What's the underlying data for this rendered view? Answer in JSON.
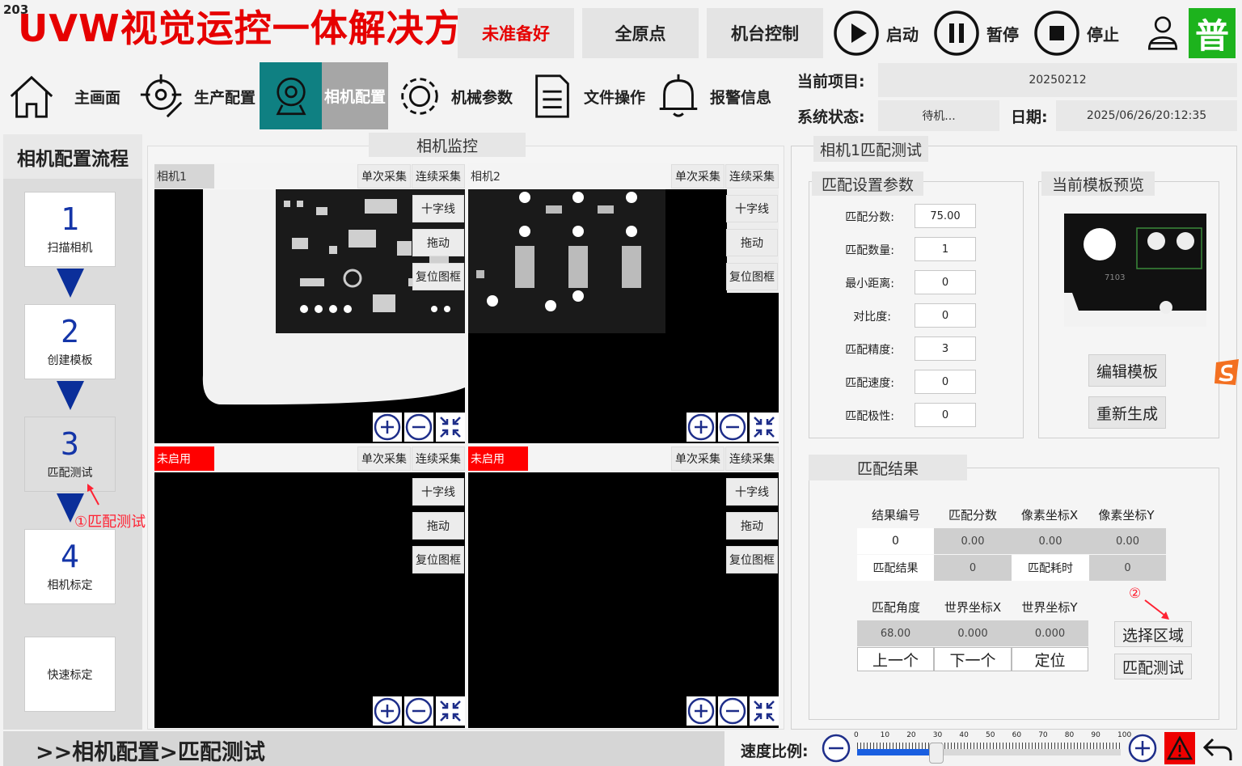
{
  "corner_number": "203",
  "app_title": "UVW视觉运控一体解决方案",
  "header": {
    "status_button": "未准备好",
    "home_button": "全原点",
    "machine_button": "机台控制",
    "start_label": "启动",
    "pause_label": "暂停",
    "stop_label": "停止",
    "user_level_badge": "普"
  },
  "nav": {
    "items": [
      {
        "label": "主画面",
        "icon": "home-icon"
      },
      {
        "label": "生产配置",
        "icon": "crosshair-gear-icon"
      },
      {
        "label": "相机配置",
        "icon": "camera-icon",
        "active": true
      },
      {
        "label": "机械参数",
        "icon": "gear-icon"
      },
      {
        "label": "文件操作",
        "icon": "document-icon"
      },
      {
        "label": "报警信息",
        "icon": "bell-icon"
      }
    ]
  },
  "info": {
    "project_label": "当前项目:",
    "project_value": "20250212",
    "system_status_label": "系统状态:",
    "system_status_value": "待机...",
    "date_label": "日期:",
    "date_value": "2025/06/26/20:12:35"
  },
  "steps": {
    "title": "相机配置流程",
    "items": [
      {
        "num": "1",
        "name": "扫描相机"
      },
      {
        "num": "2",
        "name": "创建模板"
      },
      {
        "num": "3",
        "name": "匹配测试"
      },
      {
        "num": "4",
        "name": "相机标定"
      }
    ],
    "quick_calibration": "快速标定",
    "annotation_1": "①匹配测试"
  },
  "monitor": {
    "title": "相机监控",
    "cameras": [
      {
        "label": "相机1",
        "enabled": true
      },
      {
        "label": "相机2",
        "enabled": true
      },
      {
        "label": "未启用",
        "enabled": false
      },
      {
        "label": "未启用",
        "enabled": false
      }
    ],
    "buttons": {
      "single": "单次采集",
      "continuous": "连续采集",
      "crosshair": "十字线",
      "drag": "拖动",
      "reset_frame": "复位图框"
    }
  },
  "match_panel": {
    "title": "相机1匹配测试",
    "settings_title": "匹配设置参数",
    "params": [
      {
        "label": "匹配分数:",
        "value": "75.00"
      },
      {
        "label": "匹配数量:",
        "value": "1"
      },
      {
        "label": "最小距离:",
        "value": "0"
      },
      {
        "label": "对比度:",
        "value": "0"
      },
      {
        "label": "匹配精度:",
        "value": "3"
      },
      {
        "label": "匹配速度:",
        "value": "0"
      },
      {
        "label": "匹配极性:",
        "value": "0"
      }
    ],
    "preview_title": "当前模板预览",
    "edit_template": "编辑模板",
    "regenerate": "重新生成",
    "results_title": "匹配结果",
    "result_headers": [
      "结果编号",
      "匹配分数",
      "像素坐标X",
      "像素坐标Y"
    ],
    "result_id": "0",
    "result_score": "0.00",
    "result_px": "0.00",
    "result_py": "0.00",
    "match_result_label": "匹配结果",
    "match_result_value": "0",
    "match_time_label": "匹配耗时",
    "match_time_value": "0",
    "angle_headers": [
      "匹配角度",
      "世界坐标X",
      "世界坐标Y"
    ],
    "angle_value": "68.00",
    "world_x": "0.000",
    "world_y": "0.000",
    "prev_button": "上一个",
    "next_button": "下一个",
    "locate_button": "定位",
    "select_region_button": "选择区域",
    "match_test_button": "匹配测试",
    "annotation_2": "②"
  },
  "bottom": {
    "breadcrumb": ">>相机配置>匹配测试",
    "speed_label": "速度比例:",
    "speed_ticks": [
      "0",
      "10",
      "20",
      "30",
      "40",
      "50",
      "60",
      "70",
      "80",
      "90",
      "100"
    ],
    "speed_value": 30
  },
  "colors": {
    "title_red": "#e60000",
    "active_teal": "#0f8082",
    "step_blue": "#0b2f9a",
    "badge_green": "#1db31d"
  }
}
